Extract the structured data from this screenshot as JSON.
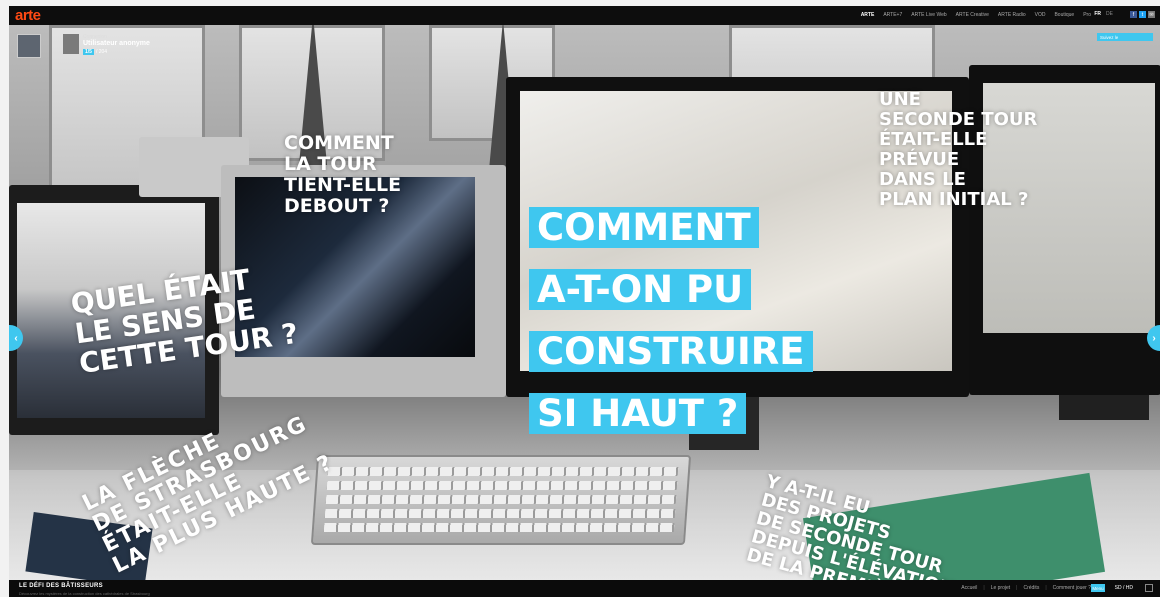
{
  "topbar": {
    "logo": "arte",
    "nav": [
      "ARTE",
      "ARTE+7",
      "ARTE Live Web",
      "ARTE Creative",
      "ARTE Radio",
      "VOD",
      "Boutique",
      "Pro"
    ],
    "languages": [
      "FR",
      "DE"
    ],
    "social": [
      "f",
      "t",
      "✉"
    ]
  },
  "user": {
    "small_label": "Connexion",
    "name": "Utilisateur anonyme",
    "count": "1/5",
    "count_total": "/ 204"
  },
  "share_label": "Suivez le",
  "questions": {
    "q1": "Comment\nla tour\ntient-elle\ndebout ?",
    "main": [
      "Comment",
      "a-t-on pu",
      "construire",
      "si haut ?"
    ],
    "q3": "Une\nseconde tour\nétait-elle\nprévue\ndans le\nplan initial ?",
    "q4": "Quel était\nle sens de\ncette tour ?",
    "q5": "La flèche\nde Strasbourg\nétait-elle\nla plus haute ?",
    "q6": "Y a-t-il eu\ndes projets\nde seconde tour\ndepuis l'élévation\nde la première ?"
  },
  "arrows": {
    "left": "‹",
    "right": "›"
  },
  "bottombar": {
    "title": "LE DÉFI DES BÂTISSEURS",
    "subtitle": "Découvrez les mystères de la construction des cathédrales de Strasbourg",
    "links": [
      "Accueil",
      "Le projet",
      "Crédits",
      "Comment jouer ?"
    ],
    "button": "Menu",
    "hd": "SD / HD"
  },
  "colors": {
    "accent": "#3fc7ef",
    "arte": "#ff4a14"
  }
}
